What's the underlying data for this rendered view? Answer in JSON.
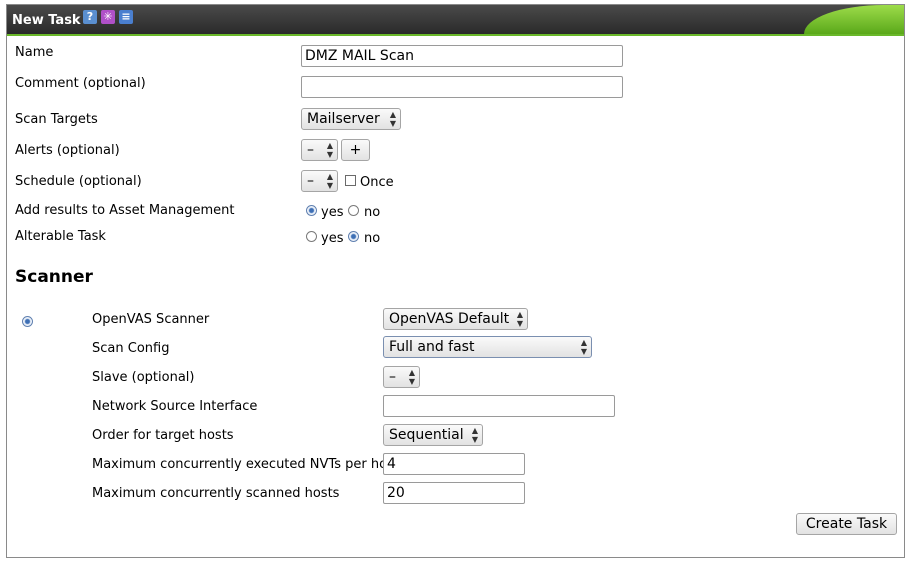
{
  "header": {
    "title": "New Task"
  },
  "fields": {
    "name_label": "Name",
    "name_value": "DMZ MAIL Scan",
    "comment_label": "Comment (optional)",
    "comment_value": "",
    "targets_label": "Scan Targets",
    "targets_value": "Mailserver",
    "alerts_label": "Alerts (optional)",
    "alerts_value": "–",
    "alerts_add": "+",
    "schedule_label": "Schedule (optional)",
    "schedule_value": "–",
    "once_label": "Once",
    "asset_label": "Add results to Asset Management",
    "asset_yes": "yes",
    "asset_no": "no",
    "asset_selected": "yes",
    "alterable_label": "Alterable Task",
    "alterable_yes": "yes",
    "alterable_no": "no",
    "alterable_selected": "no"
  },
  "scanner": {
    "heading": "Scanner",
    "openvas_label": "OpenVAS Scanner",
    "openvas_value": "OpenVAS Default",
    "config_label": "Scan Config",
    "config_value": "Full and fast",
    "slave_label": "Slave (optional)",
    "slave_value": "–",
    "iface_label": "Network Source Interface",
    "iface_value": "",
    "order_label": "Order for target hosts",
    "order_value": "Sequential",
    "max_nvts_label": "Maximum concurrently executed NVTs per host",
    "max_nvts_value": "4",
    "max_hosts_label": "Maximum concurrently scanned hosts",
    "max_hosts_value": "20"
  },
  "actions": {
    "create": "Create Task"
  },
  "icons": {
    "help": "help-icon",
    "wizard": "wizard-icon",
    "list": "list-icon"
  }
}
